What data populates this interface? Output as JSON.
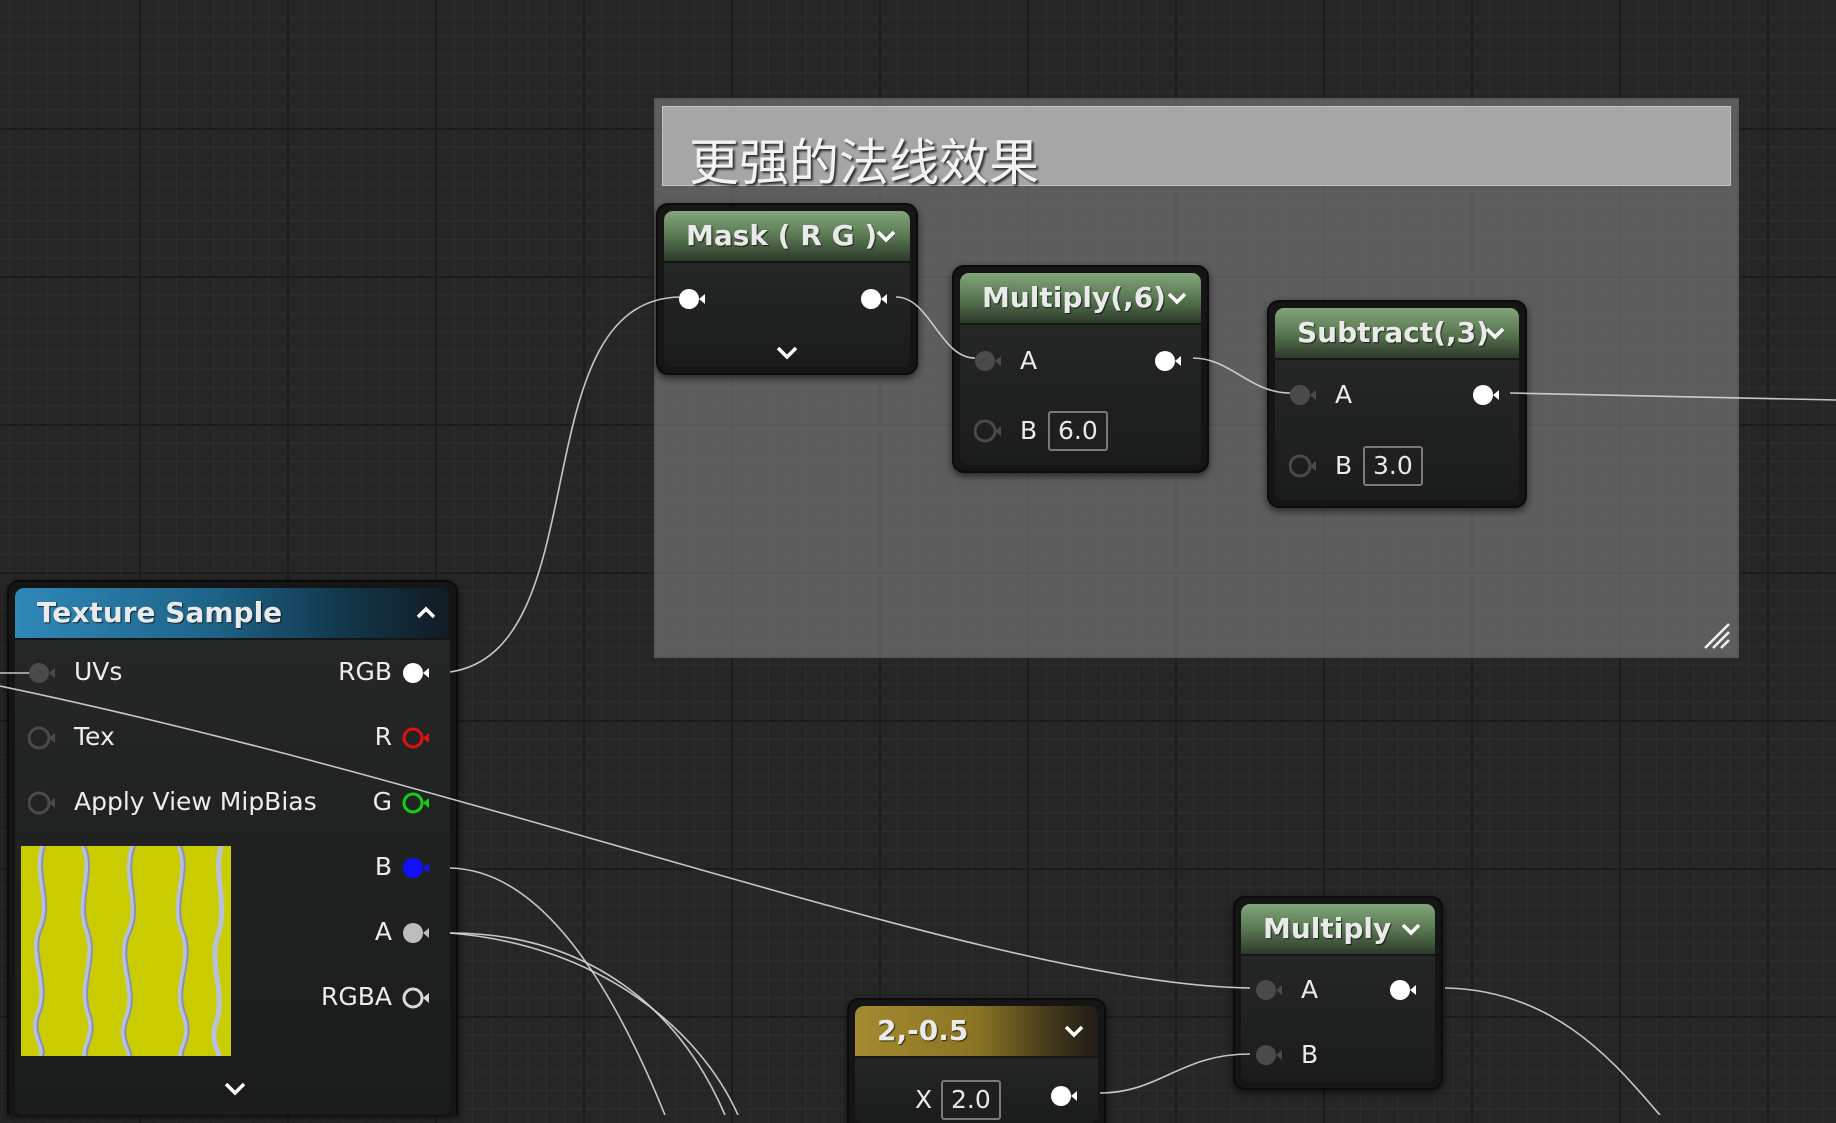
{
  "comment": {
    "title": "更强的法线效果"
  },
  "nodes": {
    "mask": {
      "title": "Mask ( R G )"
    },
    "multiply6": {
      "title": "Multiply(,6)",
      "pin_a": "A",
      "pin_b": "B",
      "b_value": "6.0"
    },
    "subtract3": {
      "title": "Subtract(,3)",
      "pin_a": "A",
      "pin_b": "B",
      "b_value": "3.0"
    },
    "texture_sample": {
      "title": "Texture Sample",
      "inputs": [
        "UVs",
        "Tex",
        "Apply View MipBias"
      ],
      "outputs": [
        "RGB",
        "R",
        "G",
        "B",
        "A",
        "RGBA"
      ]
    },
    "multiply": {
      "title": "Multiply",
      "pin_a": "A",
      "pin_b": "B"
    },
    "constant2": {
      "title": "2,-0.5",
      "pin_x": "X",
      "x_value": "2.0"
    }
  },
  "pin_colors": {
    "white": "#ffffff",
    "red": "#e01010",
    "green": "#10d010",
    "blue": "#1010ff",
    "gray": "#bdbdbd",
    "empty": "#4a4a4a"
  },
  "thumbnail_colors": {
    "base": "#c8cc00",
    "vein": "#b8c0e0"
  }
}
